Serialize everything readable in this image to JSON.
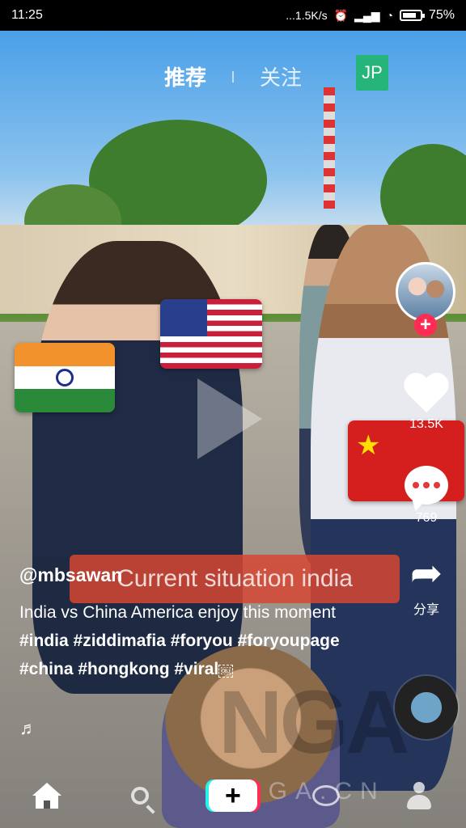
{
  "status_bar": {
    "time": "11:25",
    "net_speed": "...1.5K/s",
    "battery_percent": "75%"
  },
  "top_nav": {
    "tab_recommend": "推荐",
    "tab_following": "关注",
    "jp_badge": "JP"
  },
  "video": {
    "overlay_caption": "Current situation india",
    "flags": [
      "india-flag",
      "usa-flag",
      "china-flag"
    ]
  },
  "side_actions": {
    "like_count": "13.5K",
    "comment_count": "769",
    "share_label": "分享"
  },
  "post": {
    "username": "@mbsawan",
    "description_text": "India vs China America enjoy this moment",
    "hashtags": [
      "#india",
      "#ziddimafia",
      "#foryou",
      "#foryoupage",
      "#china",
      "#hongkong",
      "#viral"
    ],
    "obj_marker": "￼",
    "music_icon": "♬"
  },
  "watermark": {
    "logo_text": "NGA",
    "site_text": "NGA.CN"
  },
  "bottom_nav": {
    "items": [
      "home-icon",
      "search-icon",
      "create-button",
      "messages-icon",
      "profile-icon"
    ],
    "create_symbol": "+"
  },
  "colors": {
    "accent_red": "#fe2c55",
    "accent_cyan": "#25f4ee",
    "jp_green": "#25b47a",
    "caption_bg": "#d64632"
  }
}
